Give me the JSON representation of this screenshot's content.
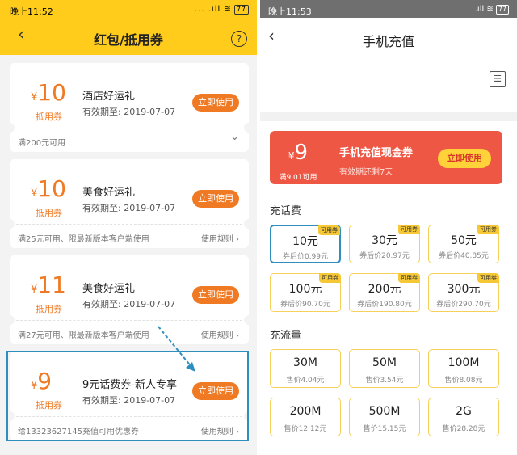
{
  "left": {
    "status_time": "晚上11:52",
    "status_icons": "... .ıll ≋",
    "battery": "77",
    "title": "红包/抵用券",
    "back_glyph": "‹",
    "help_glyph": "?",
    "coupons": [
      {
        "yen": "¥",
        "amount": "10",
        "type": "抵用券",
        "name": "酒店好运礼",
        "valid": "有效期至: 2019-07-07",
        "button": "立即使用",
        "condition": "满200元可用",
        "rule": "",
        "chevron": "⌄"
      },
      {
        "yen": "¥",
        "amount": "10",
        "type": "抵用券",
        "name": "美食好运礼",
        "valid": "有效期至: 2019-07-07",
        "button": "立即使用",
        "condition": "满25元可用、限最新版本客户端使用",
        "rule": "使用规则 ›",
        "chevron": ""
      },
      {
        "yen": "¥",
        "amount": "11",
        "type": "抵用券",
        "name": "美食好运礼",
        "valid": "有效期至: 2019-07-07",
        "button": "立即使用",
        "condition": "满27元可用、限最新版本客户端使用",
        "rule": "使用规则 ›",
        "chevron": ""
      },
      {
        "yen": "¥",
        "amount": "9",
        "type": "抵用券",
        "name": "9元话费券-新人专享",
        "valid": "有效期至: 2019-07-07",
        "button": "立即使用",
        "condition": "给13323627145充值可用优惠券",
        "rule": "使用规则 ›",
        "chevron": ""
      }
    ]
  },
  "right": {
    "status_time": "晚上11:53",
    "status_icons": ".ıll ≋",
    "battery": "77",
    "title": "手机充值",
    "back_glyph": "‹",
    "contact_glyph": "☰",
    "banner": {
      "yen": "¥",
      "amount": "9",
      "condition": "满9.01可用",
      "name": "手机充值现金券",
      "valid": "有效期还剩7天",
      "button": "立即使用"
    },
    "recharge_title": "充话费",
    "recharge": [
      {
        "main": "10元",
        "sub": "券后价0.99元",
        "tag": "可用券"
      },
      {
        "main": "30元",
        "sub": "券后价20.97元",
        "tag": "可用券"
      },
      {
        "main": "50元",
        "sub": "券后价40.85元",
        "tag": "可用券"
      },
      {
        "main": "100元",
        "sub": "券后价90.70元",
        "tag": "可用券"
      },
      {
        "main": "200元",
        "sub": "券后价190.80元",
        "tag": "可用券"
      },
      {
        "main": "300元",
        "sub": "券后价290.70元",
        "tag": "可用券"
      }
    ],
    "data_title": "充流量",
    "data": [
      {
        "main": "30M",
        "sub": "售价4.04元"
      },
      {
        "main": "50M",
        "sub": "售价3.54元"
      },
      {
        "main": "100M",
        "sub": "售价8.08元"
      },
      {
        "main": "200M",
        "sub": "售价12.12元"
      },
      {
        "main": "500M",
        "sub": "售价15.15元"
      },
      {
        "main": "2G",
        "sub": "售价28.28元"
      }
    ]
  },
  "colors": {
    "header_yellow": "#ffcc1c",
    "accent_orange": "#f07a24",
    "highlight_blue": "#2e8fbf",
    "banner_red": "#ee5744",
    "tile_border": "#f6d15a"
  }
}
